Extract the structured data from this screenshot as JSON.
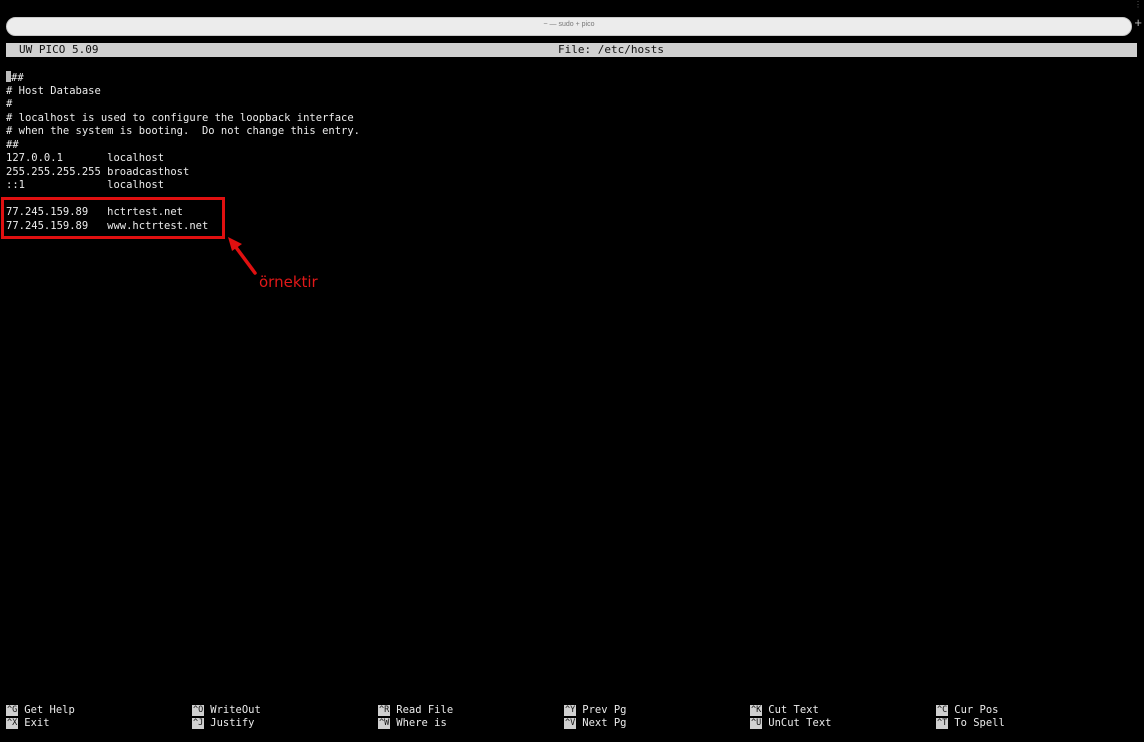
{
  "window": {
    "tab_title": "~ — sudo + pico",
    "new_tab_symbol": "+",
    "corner_symbol": "⋮"
  },
  "status_bar": {
    "app_version": "UW PICO 5.09",
    "file_label": "File: /etc/hosts"
  },
  "editor": {
    "lines": [
      "##",
      "# Host Database",
      "#",
      "# localhost is used to configure the loopback interface",
      "# when the system is booting.  Do not change this entry.",
      "##",
      "127.0.0.1       localhost",
      "255.255.255.255 broadcasthost",
      "::1             localhost",
      "",
      "77.245.159.89   hctrtest.net",
      "77.245.159.89   www.hctrtest.net"
    ]
  },
  "annotation": {
    "label": "örnektir",
    "color": "#e01010"
  },
  "shortcuts": [
    {
      "key": "^G",
      "label": "Get Help"
    },
    {
      "key": "^X",
      "label": "Exit"
    },
    {
      "key": "^O",
      "label": "WriteOut"
    },
    {
      "key": "^J",
      "label": "Justify"
    },
    {
      "key": "^R",
      "label": "Read File"
    },
    {
      "key": "^W",
      "label": "Where is"
    },
    {
      "key": "^Y",
      "label": "Prev Pg"
    },
    {
      "key": "^V",
      "label": "Next Pg"
    },
    {
      "key": "^K",
      "label": "Cut Text"
    },
    {
      "key": "^U",
      "label": "UnCut Text"
    },
    {
      "key": "^C",
      "label": "Cur Pos"
    },
    {
      "key": "^T",
      "label": "To Spell"
    }
  ]
}
